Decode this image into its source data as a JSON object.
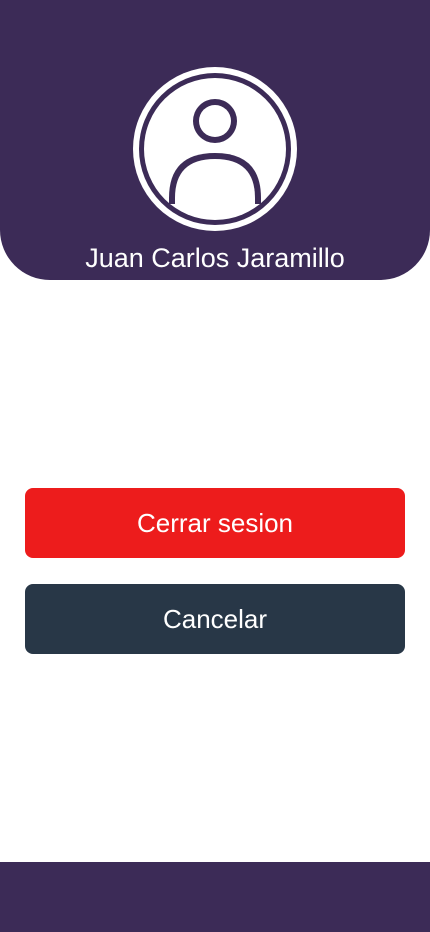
{
  "profile": {
    "name": "Juan Carlos Jaramillo",
    "avatar_icon": "user-avatar-icon"
  },
  "actions": {
    "logout_label": "Cerrar sesion",
    "cancel_label": "Cancelar"
  },
  "colors": {
    "primary": "#3c2b57",
    "logout": "#ed1c1c",
    "cancel": "#283747",
    "text_on_color": "#ffffff"
  }
}
